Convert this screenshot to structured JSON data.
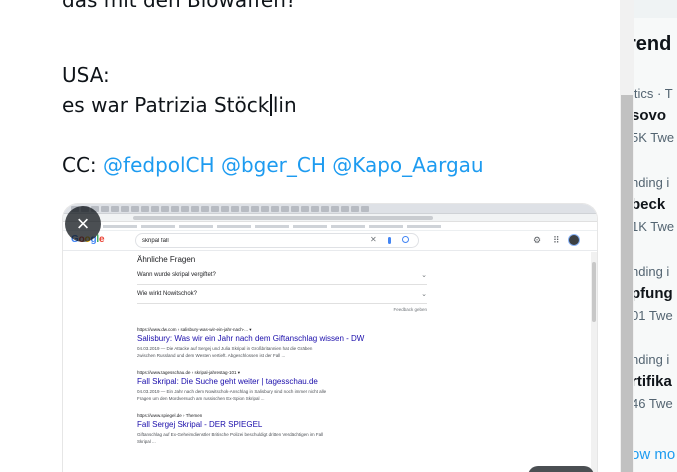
{
  "tweet": {
    "line_partial": "das mit den Biowaffen?",
    "line_usa": "USA:",
    "line_name_before_caret": "es war Patrizia Stöck",
    "line_name_after_caret": "lin",
    "cc_label": "CC:",
    "mentions": [
      "@fedpolCH",
      "@bger_CH",
      "@Kapo_Aargau"
    ]
  },
  "attachment": {
    "remove_icon": "×",
    "google": {
      "logo": [
        "G",
        "o",
        "o",
        "g",
        "l",
        "e"
      ],
      "query": "skripal fall",
      "paa_title": "Ähnliche Fragen",
      "paa_items": [
        "Wann wurde skripal vergiftet?",
        "Wie wirkt Nowitschok?"
      ],
      "feedback": "Feedback geben",
      "results": [
        {
          "cite": "https://www.dw.com › salisbury-was-wir-ein-jahr-nach-... ▾",
          "title": "Salisbury: Was wir ein Jahr nach dem Giftanschlag wissen - DW",
          "snippet1": "04.03.2019 — Die Attacke auf Sergej und Julia Skripal in Großbritannien hat die Gräben",
          "snippet2": "zwischen Russland und dem Westen vertieft. Abgeschlossen ist der Fall ..."
        },
        {
          "cite": "https://www.tagesschau.de › skripal-jahrestag-101 ▾",
          "title": "Fall Skripal: Die Suche geht weiter | tagesschau.de",
          "snippet1": "04.03.2019 — Ein Jahr nach dem Nowitschok-Anschlag in Salisbury sind noch immer nicht alle",
          "snippet2": "Fragen um den Mordversuch am russischen Ex-Spion Skripal ..."
        },
        {
          "cite": "https://www.spiegel.de › Themen",
          "title": "Fall Sergej Skripal - DER SPIEGEL",
          "snippet1": "Giftanschlag auf Ex-Geheimdienstler Britische Polizei beschuldigt dritten Verdächtigen im Fall",
          "snippet2": "Skripal ..."
        }
      ]
    }
  },
  "sidebar": {
    "title": "rend",
    "trends": [
      {
        "context": "itics · T",
        "name": "sovo",
        "count": "5K Twe"
      },
      {
        "context": "nding i",
        "name": "beck",
        "count": "1K Twe"
      },
      {
        "context": "nding i",
        "name": "pfung",
        "count": "01 Twe"
      },
      {
        "context": "nding i",
        "name": "rtifika",
        "count": "46 Twe"
      }
    ],
    "show_more": "ow mo"
  }
}
